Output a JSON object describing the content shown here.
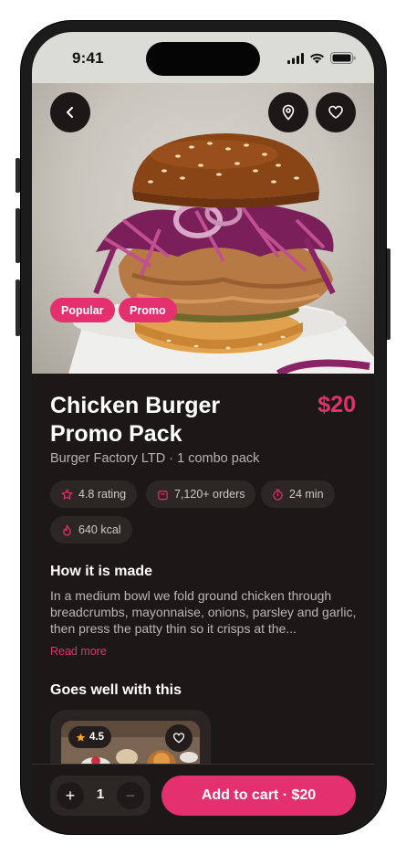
{
  "status_bar": {
    "time": "9:41"
  },
  "hero": {
    "badges": [
      "Popular",
      "Promo"
    ],
    "icons": {
      "back": "chevron-left-icon",
      "location": "map-pin-icon",
      "favorite": "heart-icon"
    }
  },
  "product": {
    "title": "Chicken Burger Promo Pack",
    "price": "$20",
    "subtitle": "Burger Factory LTD · 1 combo pack",
    "stats": [
      {
        "icon": "star-icon",
        "label": "4.8 rating"
      },
      {
        "icon": "bag-icon",
        "label": "7,120+ orders"
      },
      {
        "icon": "timer-icon",
        "label": "24 min"
      },
      {
        "icon": "flame-icon",
        "label": "640 kcal"
      }
    ]
  },
  "how_made": {
    "heading": "How it is made",
    "text": "In a medium bowl we fold ground chicken through breadcrumbs, mayonnaise, onions, parsley and garlic, then press the patty thin so it crisps at the...",
    "read_more": "Read more"
  },
  "pairings": {
    "heading": "Goes well with this",
    "items": [
      {
        "rating": "4.5"
      }
    ]
  },
  "cart": {
    "quantity": "1",
    "plus": "+",
    "minus": "−",
    "button_label": "Add to cart · $20"
  },
  "colors": {
    "accent": "#e4306e",
    "background": "#1c1818",
    "chip": "#2c2625"
  }
}
